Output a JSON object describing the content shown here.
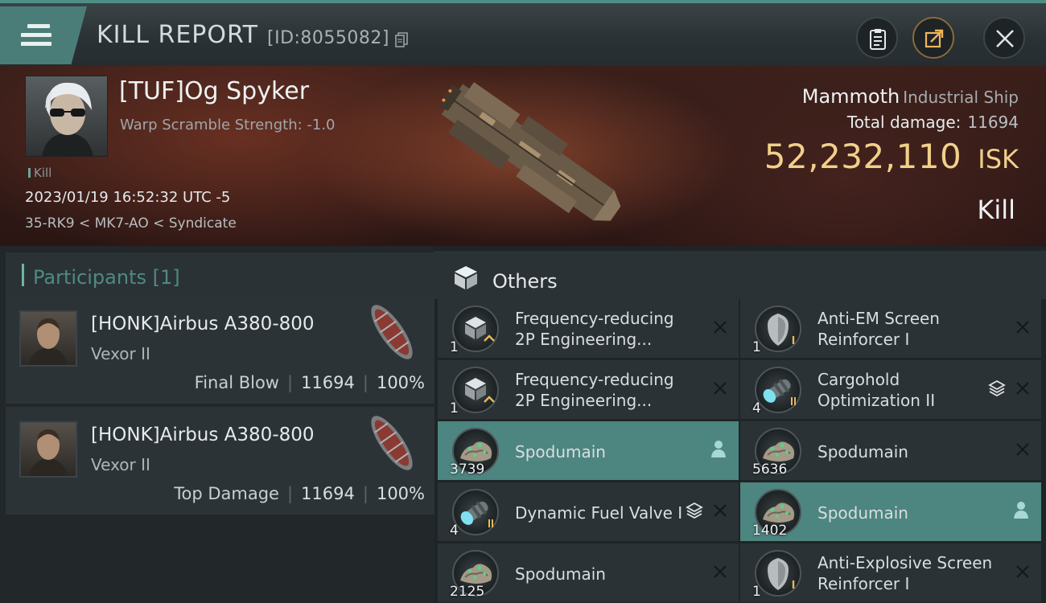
{
  "header": {
    "title": "KILL REPORT",
    "report_id": "[ID:8055082]"
  },
  "victim": {
    "name": "[TUF]Og Spyker",
    "warp_scramble": "Warp Scramble Strength: -1.0",
    "tag": "Kill",
    "datetime": "2023/01/19 16:52:32 UTC -5",
    "location": "35-RK9 < MK7-AO < Syndicate",
    "ship_name": "Mammoth",
    "ship_class": "Industrial Ship",
    "total_damage_label": "Total damage:",
    "total_damage": "11694",
    "isk_value": "52,232,110",
    "isk_unit": "ISK",
    "outcome": "Kill"
  },
  "participants": {
    "title": "Participants [1]",
    "cards": [
      {
        "name": "[HONK]Airbus A380-800",
        "ship": "Vexor II",
        "label": "Final Blow",
        "damage": "11694",
        "percent": "100%"
      },
      {
        "name": "[HONK]Airbus A380-800",
        "ship": "Vexor II",
        "label": "Top Damage",
        "damage": "11694",
        "percent": "100%"
      }
    ]
  },
  "others": {
    "title": "Others",
    "items": [
      {
        "name": "Frequency-reducing 2P Engineering...",
        "qty": "1",
        "icon": "module-chip-icon",
        "active": false
      },
      {
        "name": "Anti-EM Screen Reinforcer I",
        "qty": "1",
        "icon": "shield-module-icon",
        "active": false
      },
      {
        "name": "Frequency-reducing 2P Engineering...",
        "qty": "1",
        "icon": "module-chip-icon",
        "active": false
      },
      {
        "name": "Cargohold Optimization II",
        "qty": "4",
        "icon": "cargo-rig-icon",
        "active": false
      },
      {
        "name": "Spodumain",
        "qty": "3739",
        "icon": "ore-icon",
        "active": true
      },
      {
        "name": "Spodumain",
        "qty": "5636",
        "icon": "ore-icon",
        "active": false
      },
      {
        "name": "Dynamic Fuel Valve I",
        "qty": "4",
        "icon": "cargo-rig-icon",
        "active": false
      },
      {
        "name": "Spodumain",
        "qty": "1402",
        "icon": "ore-icon",
        "active": true
      },
      {
        "name": "Spodumain",
        "qty": "2125",
        "icon": "ore-icon",
        "active": false
      },
      {
        "name": "Anti-Explosive Screen Reinforcer I",
        "qty": "1",
        "icon": "shield-module-icon",
        "active": false
      }
    ]
  },
  "colors": {
    "accent": "#4d8580",
    "isk": "#f1d08a",
    "participants_title": "#4f8a84"
  }
}
